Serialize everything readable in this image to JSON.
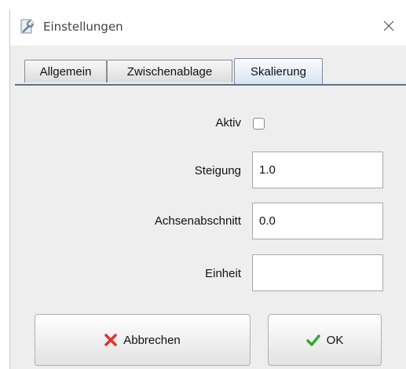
{
  "window": {
    "title": "Einstellungen",
    "icon": "wrench-settings-icon",
    "close_icon": "close-icon"
  },
  "tabs": [
    {
      "label": "Allgemein",
      "active": false
    },
    {
      "label": "Zwischenablage",
      "active": false
    },
    {
      "label": "Skalierung",
      "active": true
    }
  ],
  "form": {
    "active_label": "Aktiv",
    "active_checked": false,
    "slope_label": "Steigung",
    "slope_value": "1.0",
    "intercept_label": "Achsenabschnitt",
    "intercept_value": "0.0",
    "unit_label": "Einheit",
    "unit_value": ""
  },
  "buttons": {
    "cancel_label": "Abbrechen",
    "cancel_icon": "red-x-icon",
    "ok_label": "OK",
    "ok_icon": "green-check-icon"
  },
  "colors": {
    "cancel_icon": "#e0322b",
    "ok_icon": "#3aa43a",
    "active_tab": "#d7e4f2"
  }
}
